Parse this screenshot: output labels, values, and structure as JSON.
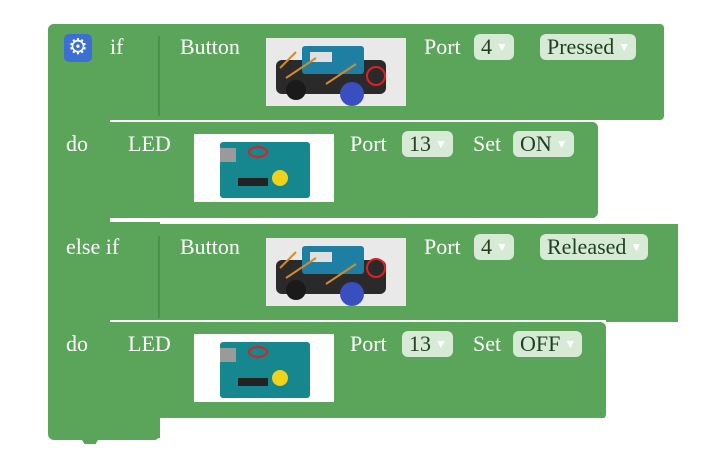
{
  "if_block": {
    "if_label": "if",
    "else_if_label": "else if",
    "do_label": "do",
    "settings_icon": "gear-icon",
    "color": "#5ba55b"
  },
  "conditions": [
    {
      "label": "Button",
      "image": "robot-car-photo",
      "port_label": "Port",
      "port": "4",
      "state": "Pressed"
    },
    {
      "label": "Button",
      "image": "robot-car-photo",
      "port_label": "Port",
      "port": "4",
      "state": "Released"
    }
  ],
  "actions": [
    {
      "label": "LED",
      "image": "arduino-board-photo",
      "port_label": "Port",
      "port": "13",
      "set_label": "Set",
      "value": "ON"
    },
    {
      "label": "LED",
      "image": "arduino-board-photo",
      "port_label": "Port",
      "port": "13",
      "set_label": "Set",
      "value": "OFF"
    }
  ],
  "dropdown_arrow": "▼"
}
